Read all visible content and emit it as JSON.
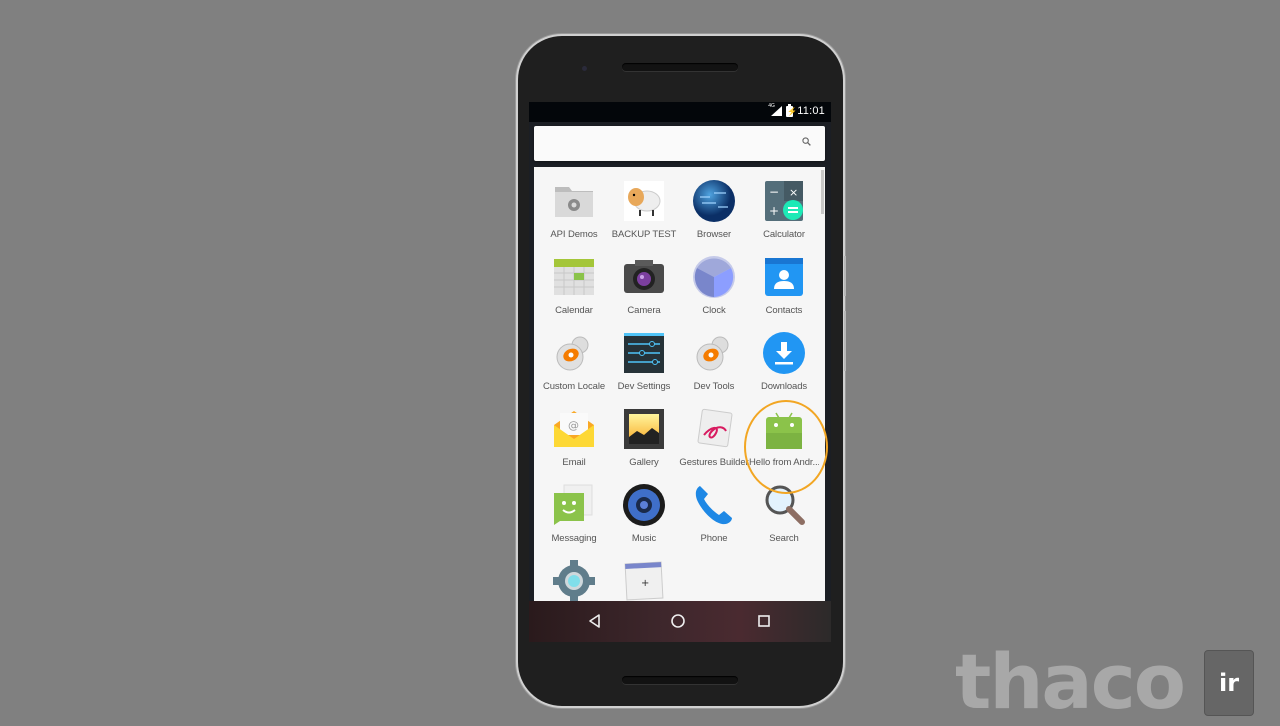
{
  "status_bar": {
    "network": "4G",
    "battery_icon": "battery-charging-icon",
    "time": "11:01"
  },
  "search": {
    "placeholder": "",
    "icon": "search-icon"
  },
  "apps": [
    {
      "label": "API Demos",
      "icon": "folder-gear-icon"
    },
    {
      "label": "BACKUP TEST",
      "icon": "sheep-icon"
    },
    {
      "label": "Browser",
      "icon": "globe-icon"
    },
    {
      "label": "Calculator",
      "icon": "calculator-icon"
    },
    {
      "label": "Calendar",
      "icon": "calendar-icon"
    },
    {
      "label": "Camera",
      "icon": "camera-icon"
    },
    {
      "label": "Clock",
      "icon": "clock-icon"
    },
    {
      "label": "Contacts",
      "icon": "contacts-icon"
    },
    {
      "label": "Custom Locale",
      "icon": "gear-orange-icon"
    },
    {
      "label": "Dev Settings",
      "icon": "sliders-icon"
    },
    {
      "label": "Dev Tools",
      "icon": "gear-orange-icon"
    },
    {
      "label": "Downloads",
      "icon": "download-icon"
    },
    {
      "label": "Email",
      "icon": "envelope-icon"
    },
    {
      "label": "Gallery",
      "icon": "gallery-icon"
    },
    {
      "label": "Gestures Builder",
      "icon": "gestures-icon"
    },
    {
      "label": "Hello from Andr...",
      "icon": "android-icon"
    },
    {
      "label": "Messaging",
      "icon": "messaging-icon"
    },
    {
      "label": "Music",
      "icon": "speaker-icon"
    },
    {
      "label": "Phone",
      "icon": "phone-icon"
    },
    {
      "label": "Search",
      "icon": "magnifier-icon"
    },
    {
      "label": "",
      "icon": "settings-gear-icon"
    },
    {
      "label": "",
      "icon": "widget-preview-icon"
    }
  ],
  "navbar": {
    "back": "back-icon",
    "home": "home-icon",
    "recents": "recents-icon"
  },
  "highlight": {
    "target": "Hello from Andr...",
    "color": "#f2a623"
  },
  "watermark": {
    "text": "thaco",
    "badge": "ir"
  }
}
